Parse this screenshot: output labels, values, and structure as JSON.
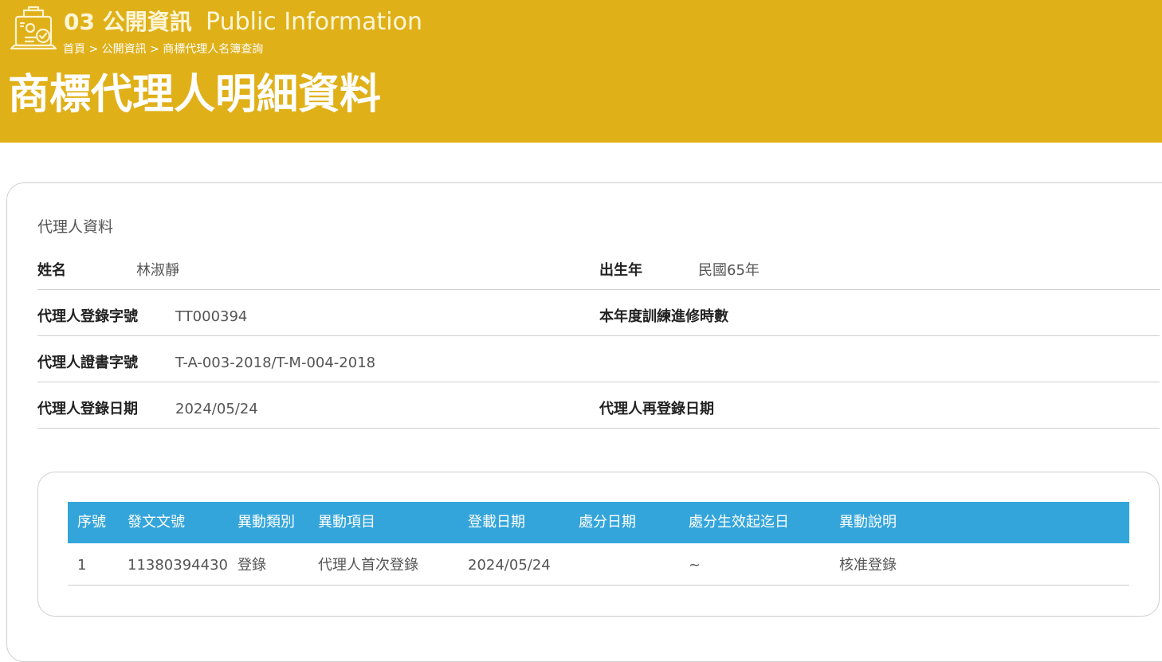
{
  "header": {
    "section_number": "03 公開資訊",
    "section_en": "Public Information",
    "breadcrumb": [
      {
        "label": "首頁"
      },
      {
        "label": "公開資訊"
      },
      {
        "label": "商標代理人名簿查詢"
      }
    ],
    "breadcrumb_separator": ">",
    "page_title": "商標代理人明細資料",
    "background_color": "#e0b018",
    "logo_icon": "document-checklist-icon"
  },
  "agent_info": {
    "title": "代理人資料",
    "name_label": "姓名",
    "name_value": "林淑靜",
    "birth_year_label": "出生年",
    "birth_year_value": "民國65年",
    "reg_no_label": "代理人登錄字號",
    "reg_no_value": "TT000394",
    "training_hours_label": "本年度訓練進修時數",
    "training_hours_value": "",
    "cert_no_label": "代理人證書字號",
    "cert_no_value": "T-A-003-2018/T-M-004-2018",
    "reg_date_label": "代理人登錄日期",
    "reg_date_value": "2024/05/24",
    "rereg_date_label": "代理人再登錄日期",
    "rereg_date_value": ""
  },
  "changes_table": {
    "header_color": "#34a5db",
    "columns": [
      "序號",
      "發文文號",
      "異動類別",
      "異動項目",
      "登載日期",
      "處分日期",
      "處分生效起迄日",
      "異動說明"
    ],
    "rows": [
      [
        "1",
        "11380394430",
        "登錄",
        "代理人首次登錄",
        "2024/05/24",
        "",
        "~",
        "核准登錄"
      ]
    ]
  }
}
